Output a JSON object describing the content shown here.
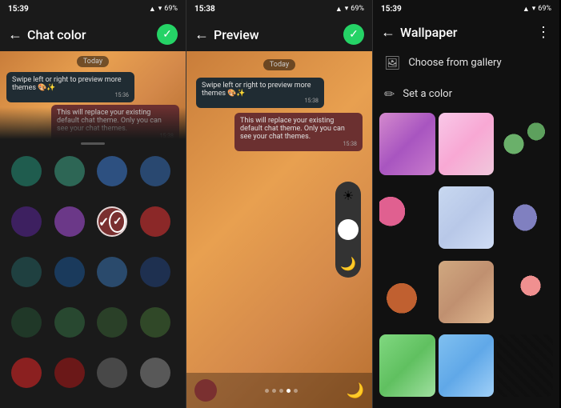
{
  "panel1": {
    "status_time": "15:39",
    "battery": "69%",
    "title": "Chat color",
    "date_label": "Today",
    "bubble1_text": "Swipe left or right to preview more themes 🎨✨",
    "bubble1_time": "15:36",
    "bubble2_text": "This will replace your existing default chat theme. Only you can see your chat themes.",
    "bubble2_time": "15:38",
    "colors": [
      {
        "id": "c1",
        "color": "#1f5c4e"
      },
      {
        "id": "c2",
        "color": "#2d6655"
      },
      {
        "id": "c3",
        "color": "#2d5080"
      },
      {
        "id": "c4",
        "color": "#294870"
      },
      {
        "id": "c5",
        "color": "#3d2060"
      },
      {
        "id": "c6",
        "color": "#6b3888"
      },
      {
        "id": "c7",
        "color": "#7a3030",
        "selected": true
      },
      {
        "id": "c8",
        "color": "#8b3030"
      },
      {
        "id": "c9",
        "color": "#1f4040"
      },
      {
        "id": "c10",
        "color": "#1a3a5c"
      },
      {
        "id": "c11",
        "color": "#2a4a6c"
      },
      {
        "id": "c12",
        "color": "#1e3050"
      },
      {
        "id": "c13",
        "color": "#203828"
      },
      {
        "id": "c14",
        "color": "#284830"
      },
      {
        "id": "c15",
        "color": "#2a4028"
      },
      {
        "id": "c16",
        "color": "#304828"
      },
      {
        "id": "c17",
        "color": "#8b2020"
      },
      {
        "id": "c18",
        "color": "#6b1818"
      },
      {
        "id": "c19",
        "color": "#404040"
      },
      {
        "id": "c20",
        "color": "#505050"
      }
    ]
  },
  "panel2": {
    "status_time": "15:38",
    "battery": "69%",
    "title": "Preview",
    "date_label": "Today",
    "bubble1_text": "Swipe left or right to preview more themes 🎨✨",
    "bubble1_time": "15:38",
    "bubble2_text": "This will replace your existing default chat theme. Only you can see your chat themes.",
    "bubble2_time": "15:38",
    "dots": [
      1,
      2,
      3,
      4,
      5
    ],
    "active_dot": 4
  },
  "panel3": {
    "status_time": "15:39",
    "battery": "69%",
    "title": "Wallpaper",
    "menu_dots": "⋮",
    "option1": "Choose from gallery",
    "option2": "Set a color",
    "wallpapers": [
      {
        "id": "wp1",
        "class": "wp-1"
      },
      {
        "id": "wp2",
        "class": "wp-2"
      },
      {
        "id": "wp3",
        "class": "wp-3"
      },
      {
        "id": "wp4",
        "class": "wp-4"
      },
      {
        "id": "wp5",
        "class": "wp-5"
      },
      {
        "id": "wp6",
        "class": "wp-6"
      },
      {
        "id": "wp7",
        "class": "wp-7"
      },
      {
        "id": "wp8",
        "class": "wp-8"
      },
      {
        "id": "wp9",
        "class": "wp-9"
      },
      {
        "id": "wp10",
        "class": "wp-10"
      },
      {
        "id": "wp11",
        "class": "wp-11"
      },
      {
        "id": "wp12",
        "class": "wp-12"
      }
    ]
  },
  "icons": {
    "back": "←",
    "check": "✓",
    "gallery": "🖼",
    "palette": "✏",
    "brightness": "☀",
    "moon": "🌙"
  }
}
